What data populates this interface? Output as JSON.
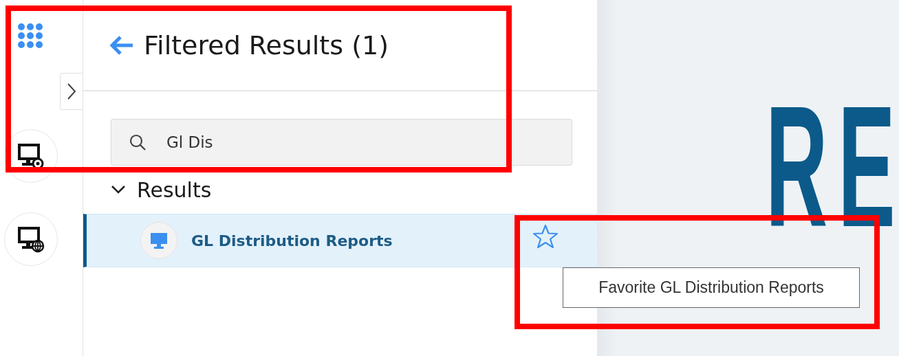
{
  "header": {
    "title": "Filtered Results (1)"
  },
  "search": {
    "value": "Gl Dis"
  },
  "results": {
    "label": "Results",
    "expanded": true,
    "items": [
      {
        "label": "GL Distribution Reports",
        "selected": true,
        "favorite": false
      }
    ]
  },
  "tooltip": {
    "text": "Favorite GL Distribution Reports"
  },
  "background_text": "RE"
}
